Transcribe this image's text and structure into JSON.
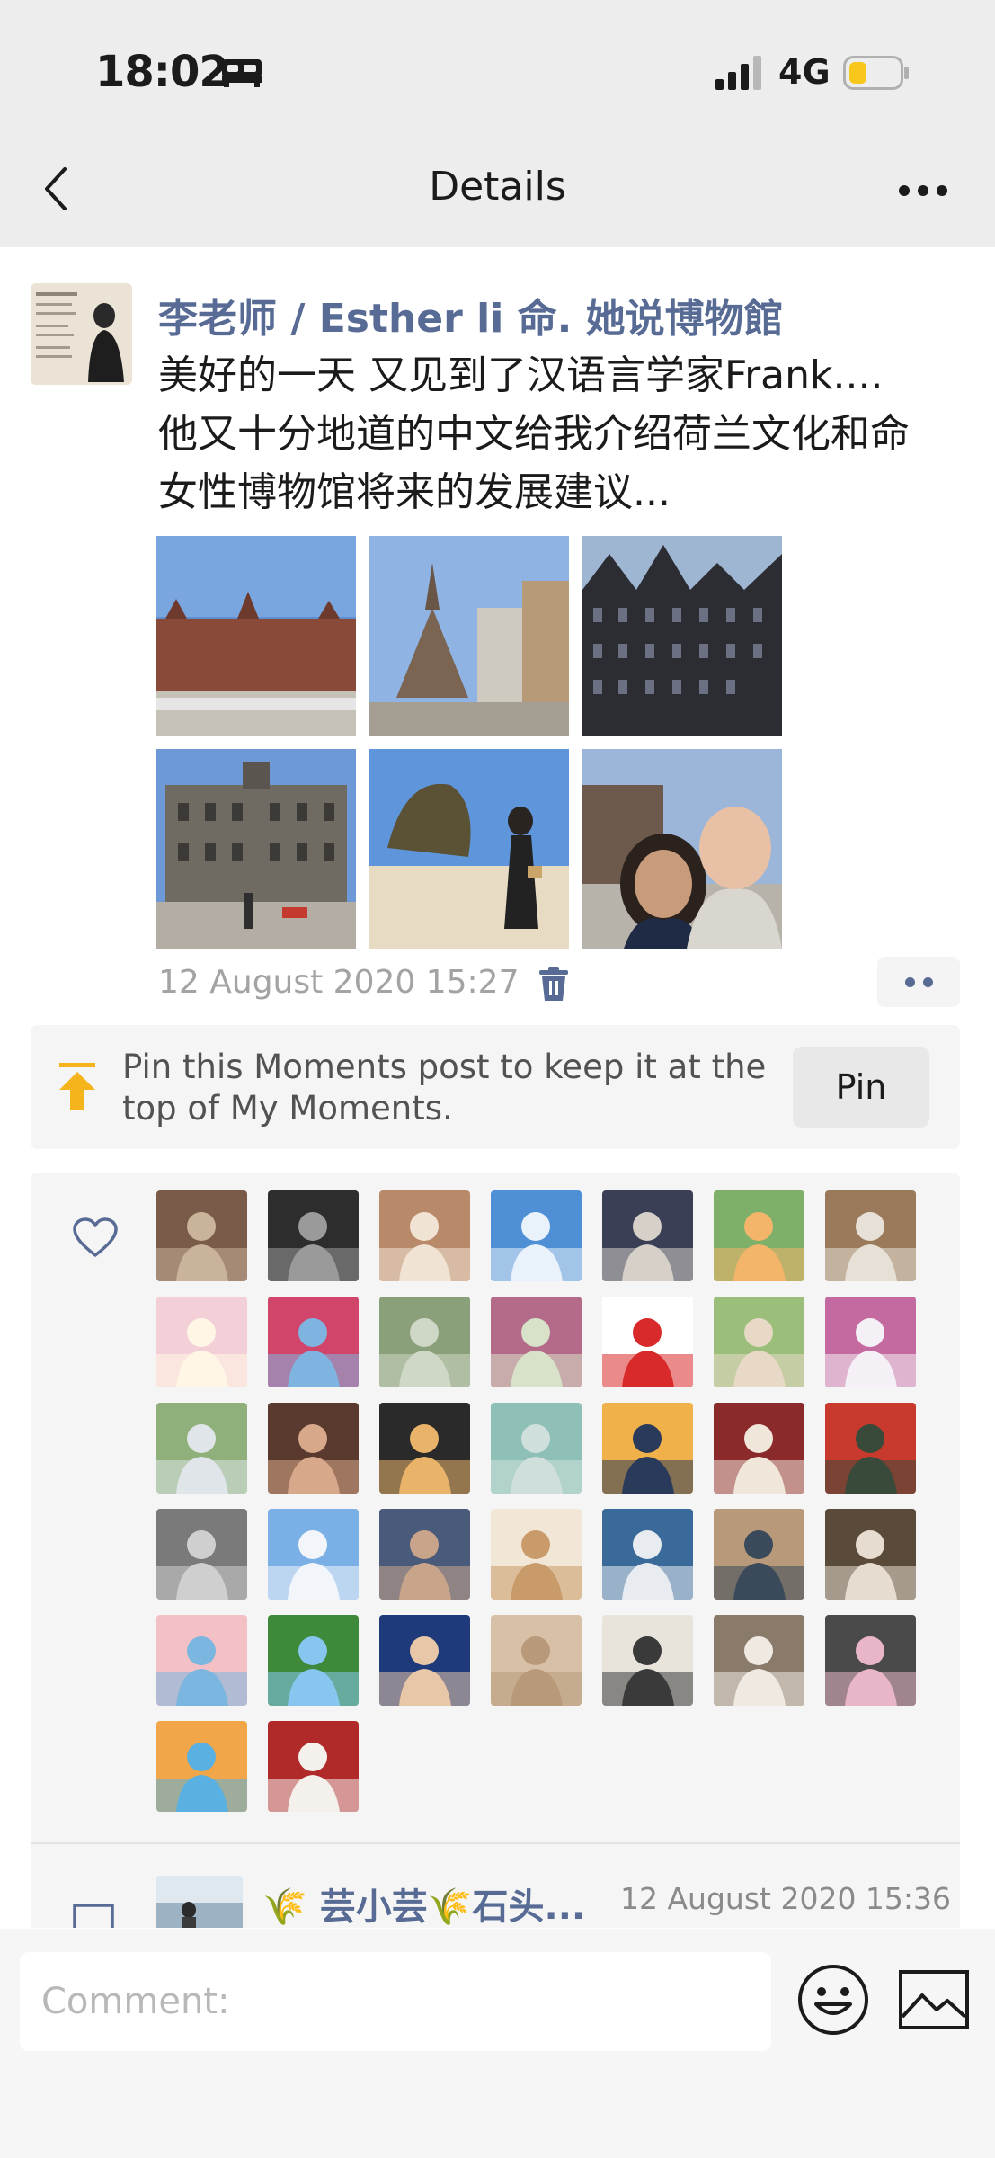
{
  "status_bar": {
    "time": "18:02",
    "network": "4G",
    "battery_level": 0.35
  },
  "nav": {
    "title": "Details"
  },
  "post": {
    "author": "李老师 / Esther li 命. 她说博物館",
    "text_lines": [
      "美好的一天 又见到了汉语言学家Frank....",
      "他又十分地道的中文给我介绍荷兰文化和命",
      "女性博物馆将来的发展建议..."
    ],
    "date": "12 August 2020 15:27",
    "photo_count": 6
  },
  "pin": {
    "message": "Pin this Moments post to keep it at the top of My Moments.",
    "button_label": "Pin"
  },
  "likes": {
    "count": 37
  },
  "comment": {
    "name": "🌾 芸小芸🌾石头...",
    "time": "12 August 2020 15:36"
  },
  "input": {
    "placeholder": "Comment:"
  },
  "colors": {
    "link": "#576b95",
    "accent_pin": "#f5b41c",
    "background": "#ededed"
  },
  "icons": [
    "back-arrow-icon",
    "more-icon",
    "trash-icon",
    "pin-top-icon",
    "heart-icon",
    "comment-icon",
    "emoji-icon",
    "image-icon",
    "bed-icon",
    "signal-icon",
    "battery-icon"
  ]
}
